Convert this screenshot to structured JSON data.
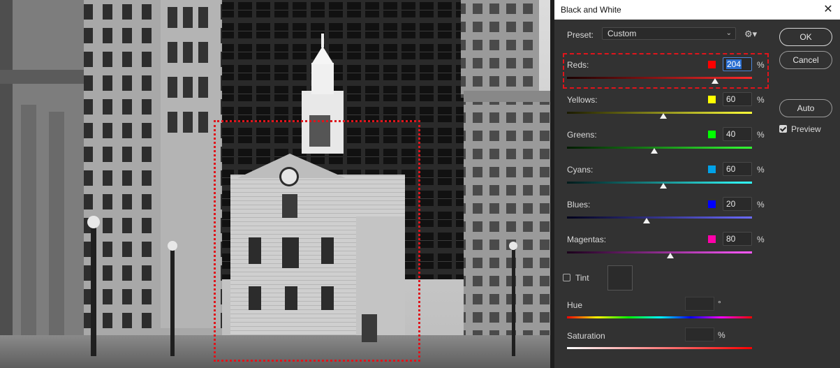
{
  "dialog": {
    "title": "Black and White",
    "close_glyph": "✕",
    "preset": {
      "label": "Preset:",
      "value": "Custom",
      "gear_glyph": "⚙▾",
      "chevron": "⌄"
    },
    "buttons": {
      "ok": "OK",
      "cancel": "Cancel",
      "auto": "Auto"
    },
    "preview": {
      "label": "Preview",
      "checked": true
    },
    "sliders": [
      {
        "key": "reds",
        "label": "Reds:",
        "value": "204",
        "unit": "%",
        "swatch": "#ff0000",
        "gradient": [
          "#1a0000",
          "#ff2a2a"
        ],
        "level": 0.8,
        "active": true
      },
      {
        "key": "yellows",
        "label": "Yellows:",
        "value": "60",
        "unit": "%",
        "swatch": "#ffff00",
        "gradient": [
          "#1a1a00",
          "#ffff3a"
        ],
        "level": 0.52
      },
      {
        "key": "greens",
        "label": "Greens:",
        "value": "40",
        "unit": "%",
        "swatch": "#00ff00",
        "gradient": [
          "#001a00",
          "#33ff33"
        ],
        "level": 0.47
      },
      {
        "key": "cyans",
        "label": "Cyans:",
        "value": "60",
        "unit": "%",
        "swatch": "#00a2e8",
        "gradient": [
          "#001a1a",
          "#33ffff"
        ],
        "level": 0.52
      },
      {
        "key": "blues",
        "label": "Blues:",
        "value": "20",
        "unit": "%",
        "swatch": "#0000ff",
        "gradient": [
          "#00001a",
          "#6b6bff"
        ],
        "level": 0.43
      },
      {
        "key": "magentas",
        "label": "Magentas:",
        "value": "80",
        "unit": "%",
        "swatch": "#ff00aa",
        "gradient": [
          "#1a001a",
          "#ff5aff"
        ],
        "level": 0.56
      }
    ],
    "tint": {
      "label": "Tint",
      "checked": false
    },
    "hue": {
      "label": "Hue",
      "unit": "°"
    },
    "saturation": {
      "label": "Saturation",
      "unit": "%"
    }
  },
  "colors": {
    "highlight": "#e0141b",
    "active_field": "#2b6fd1"
  }
}
